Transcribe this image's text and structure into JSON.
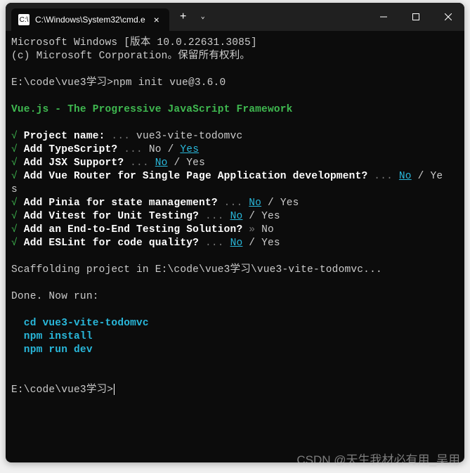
{
  "tab": {
    "title": "C:\\Windows\\System32\\cmd.e",
    "icon_text": "C:\\"
  },
  "header": {
    "line1": "Microsoft Windows [版本 10.0.22631.3085]",
    "line2": "(c) Microsoft Corporation。保留所有权利。"
  },
  "prompt1": {
    "path": "E:\\code\\vue3学习>",
    "cmd": "npm init vue@3.6.0"
  },
  "banner": "Vue.js - The Progressive JavaScript Framework",
  "questions": [
    {
      "check": "√",
      "label": " Project name:",
      "dots": " ... ",
      "value": "vue3-vite-todomvc"
    },
    {
      "check": "√",
      "label": " Add TypeScript?",
      "dots": " ... ",
      "no": "No",
      "sep": " / ",
      "yes": "Yes",
      "highlight": "yes"
    },
    {
      "check": "√",
      "label": " Add JSX Support?",
      "dots": " ... ",
      "no": "No",
      "sep": " / ",
      "yes": "Yes",
      "highlight": "no"
    },
    {
      "check": "√",
      "label": " Add Vue Router for Single Page Application development?",
      "dots": " ... ",
      "no": "No",
      "sep": " / ",
      "yes": "Yes",
      "highlight": "no",
      "wrap": true
    },
    {
      "check": "√",
      "label": " Add Pinia for state management?",
      "dots": " ... ",
      "no": "No",
      "sep": " / ",
      "yes": "Yes",
      "highlight": "no"
    },
    {
      "check": "√",
      "label": " Add Vitest for Unit Testing?",
      "dots": " ... ",
      "no": "No",
      "sep": " / ",
      "yes": "Yes",
      "highlight": "no"
    },
    {
      "check": "√",
      "label": " Add an End-to-End Testing Solution?",
      "arrow": " » ",
      "value": "No"
    },
    {
      "check": "√",
      "label": " Add ESLint for code quality?",
      "dots": " ... ",
      "no": "No",
      "sep": " / ",
      "yes": "Yes",
      "highlight": "no"
    }
  ],
  "scaffolding": "Scaffolding project in E:\\code\\vue3学习\\vue3-vite-todomvc...",
  "done": "Done. Now run:",
  "commands": [
    "  cd vue3-vite-todomvc",
    "  npm install",
    "  npm run dev"
  ],
  "prompt2": "E:\\code\\vue3学习>",
  "watermark": "CSDN @天生我材必有用_吴用"
}
